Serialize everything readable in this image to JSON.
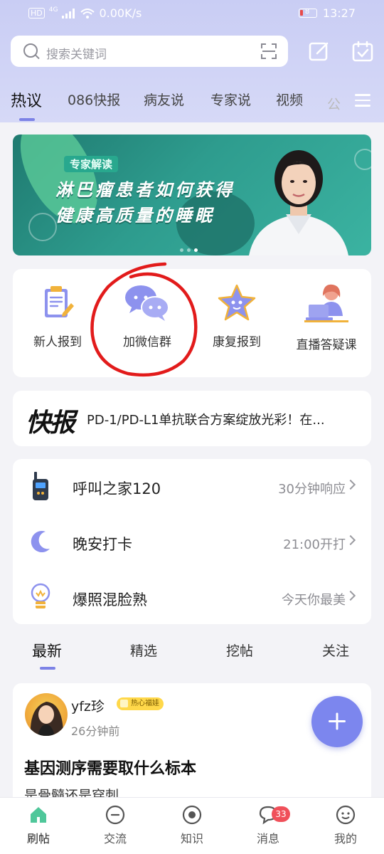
{
  "status_bar": {
    "left_hd": "HD",
    "left_net": "4G",
    "speed": "0.00K/s",
    "battery": "8",
    "time": "13:27"
  },
  "search": {
    "placeholder": "搜索关键词"
  },
  "category_tabs": [
    {
      "label": "热议",
      "active": true
    },
    {
      "label": "086快报"
    },
    {
      "label": "病友说"
    },
    {
      "label": "专家说"
    },
    {
      "label": "视频"
    },
    {
      "label": "公"
    }
  ],
  "banner": {
    "tag": "专家解读",
    "line1": "淋巴瘤患者如何获得",
    "line2": "健康高质量的睡眠"
  },
  "features": [
    {
      "label": "新人报到",
      "icon": "clipboard-icon"
    },
    {
      "label": "加微信群",
      "icon": "wechat-group-icon"
    },
    {
      "label": "康复报到",
      "icon": "star-icon"
    },
    {
      "label": "直播答疑课",
      "icon": "live-class-icon"
    }
  ],
  "news": {
    "logo": "快报",
    "text": "PD-1/PD-L1单抗联合方案绽放光彩！在..."
  },
  "quick_list": [
    {
      "title": "呼叫之家120",
      "right": "30分钟响应",
      "icon": "walkie-talkie-icon"
    },
    {
      "title": "晚安打卡",
      "right": "21:00开打",
      "icon": "moon-icon"
    },
    {
      "title": "爆照混脸熟",
      "right": "今天你最美",
      "icon": "lightbulb-icon"
    }
  ],
  "feed_tabs": [
    {
      "label": "最新",
      "active": true
    },
    {
      "label": "精选"
    },
    {
      "label": "挖帖"
    },
    {
      "label": "关注"
    }
  ],
  "post": {
    "user": "yfz珍",
    "badge": "热心福娃",
    "time": "26分钟前",
    "title": "基因测序需要取什么标本",
    "subtitle": "是骨髓还是穿刺"
  },
  "bottom_nav": [
    {
      "label": "刷帖",
      "active": true
    },
    {
      "label": "交流"
    },
    {
      "label": "知识"
    },
    {
      "label": "消息",
      "badge": "33"
    },
    {
      "label": "我的"
    }
  ],
  "colors": {
    "accent": "#7c82e6",
    "header_bg": "#c9cdf4",
    "badge_red": "#f0505a",
    "annotation_red": "#e21b1b"
  }
}
